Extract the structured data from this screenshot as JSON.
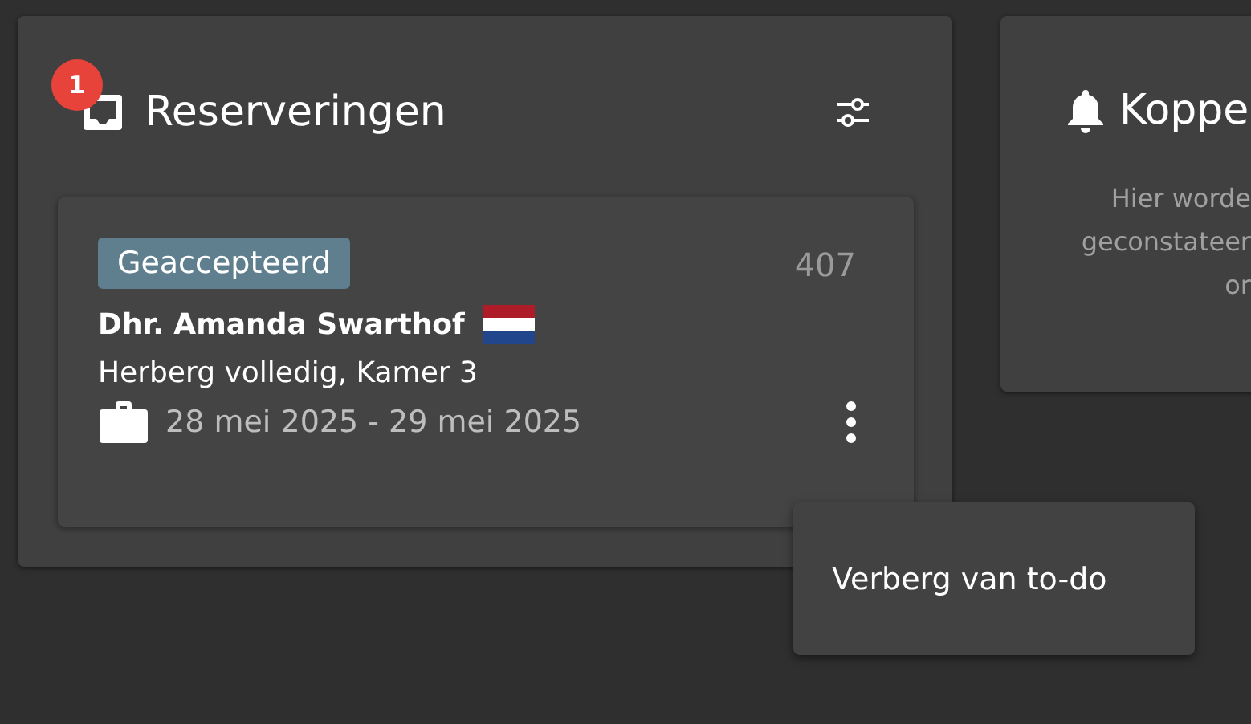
{
  "reservations_panel": {
    "title": "Reserveringen",
    "badge": "1",
    "cards": [
      {
        "status": "Geaccepteerd",
        "number": "407",
        "guest": "Dhr. Amanda Swarthof",
        "room": "Herberg volledig, Kamer 3",
        "dates": "28 mei 2025 - 29 mei 2025"
      }
    ]
  },
  "notifications_panel": {
    "title": "Koppe",
    "description_lines": [
      "Hier worde",
      "geconstateer",
      "or"
    ]
  },
  "context_menu": {
    "items": [
      "Verberg van to-do"
    ]
  }
}
